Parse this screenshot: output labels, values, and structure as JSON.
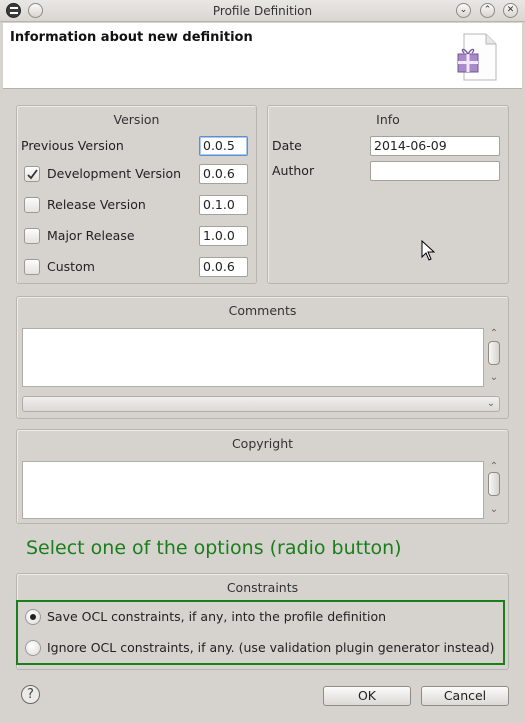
{
  "window": {
    "title": "Profile Definition"
  },
  "header": {
    "title": "Information about new definition",
    "icon": "new-profile-wizard-icon"
  },
  "version_group": {
    "title": "Version",
    "previous_label": "Previous Version",
    "previous_value": "0.0.5",
    "options": [
      {
        "label": "Development Version",
        "value": "0.0.6",
        "checked": true
      },
      {
        "label": "Release Version",
        "value": "0.1.0",
        "checked": false
      },
      {
        "label": "Major Release",
        "value": "1.0.0",
        "checked": false
      },
      {
        "label": "Custom",
        "value": "0.0.6",
        "checked": false
      }
    ]
  },
  "info_group": {
    "title": "Info",
    "date_label": "Date",
    "date_value": "2014-06-09",
    "author_label": "Author",
    "author_value": ""
  },
  "comments_group": {
    "title": "Comments"
  },
  "copyright_group": {
    "title": "Copyright"
  },
  "hint_text": "Select one of the options (radio button)",
  "constraints_group": {
    "title": "Constraints",
    "options": [
      {
        "label": "Save OCL constraints, if any, into the profile definition",
        "selected": true
      },
      {
        "label": "Ignore OCL constraints, if any. (use validation plugin generator instead)",
        "selected": false
      }
    ]
  },
  "buttons": {
    "ok": "OK",
    "cancel": "Cancel",
    "help": "?"
  },
  "colors": {
    "hint_green": "#1a7e1a",
    "focus_blue": "#5b8fd0"
  }
}
